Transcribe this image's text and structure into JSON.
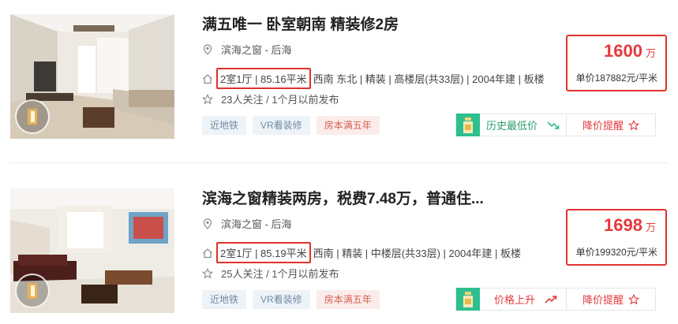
{
  "listings": [
    {
      "title": "满五唯一 卧室朝南 精装修2房",
      "location": "滨海之窗 - 后海",
      "layout_area": "2室1厅 | 85.16平米",
      "details": "西南 东北 | 精装 | 高楼层(共33层) | 2004年建 | 板楼",
      "follow": "23人关注 / 1个月以前发布",
      "tags": [
        "近地铁",
        "VR看装修",
        "房本满五年"
      ],
      "price": "1600",
      "price_unit": "万",
      "unit_price": "单价187882元/平米",
      "history_label": "历史最低价",
      "history_color": "#2a9d6f",
      "history_trend": "down-trend-icon",
      "alert_label": "降价提醒"
    },
    {
      "title": "滨海之窗精装两房，税费7.48万，普通住...",
      "location": "滨海之窗 - 后海",
      "layout_area": "2室1厅 | 85.19平米",
      "details": "西南 | 精装 | 中楼层(共33层) | 2004年建 | 板楼",
      "follow": "25人关注 / 1个月以前发布",
      "tags": [
        "近地铁",
        "VR看装修",
        "房本满五年"
      ],
      "price": "1698",
      "price_unit": "万",
      "unit_price": "单价199320元/平米",
      "history_label": "价格上升",
      "history_color": "#e4393c",
      "history_trend": "up-trend-icon",
      "alert_label": "降价提醒"
    }
  ],
  "colors": {
    "accent_red": "#e4393c",
    "highlight_border": "#e0322b",
    "history_green": "#2dbf8e"
  }
}
